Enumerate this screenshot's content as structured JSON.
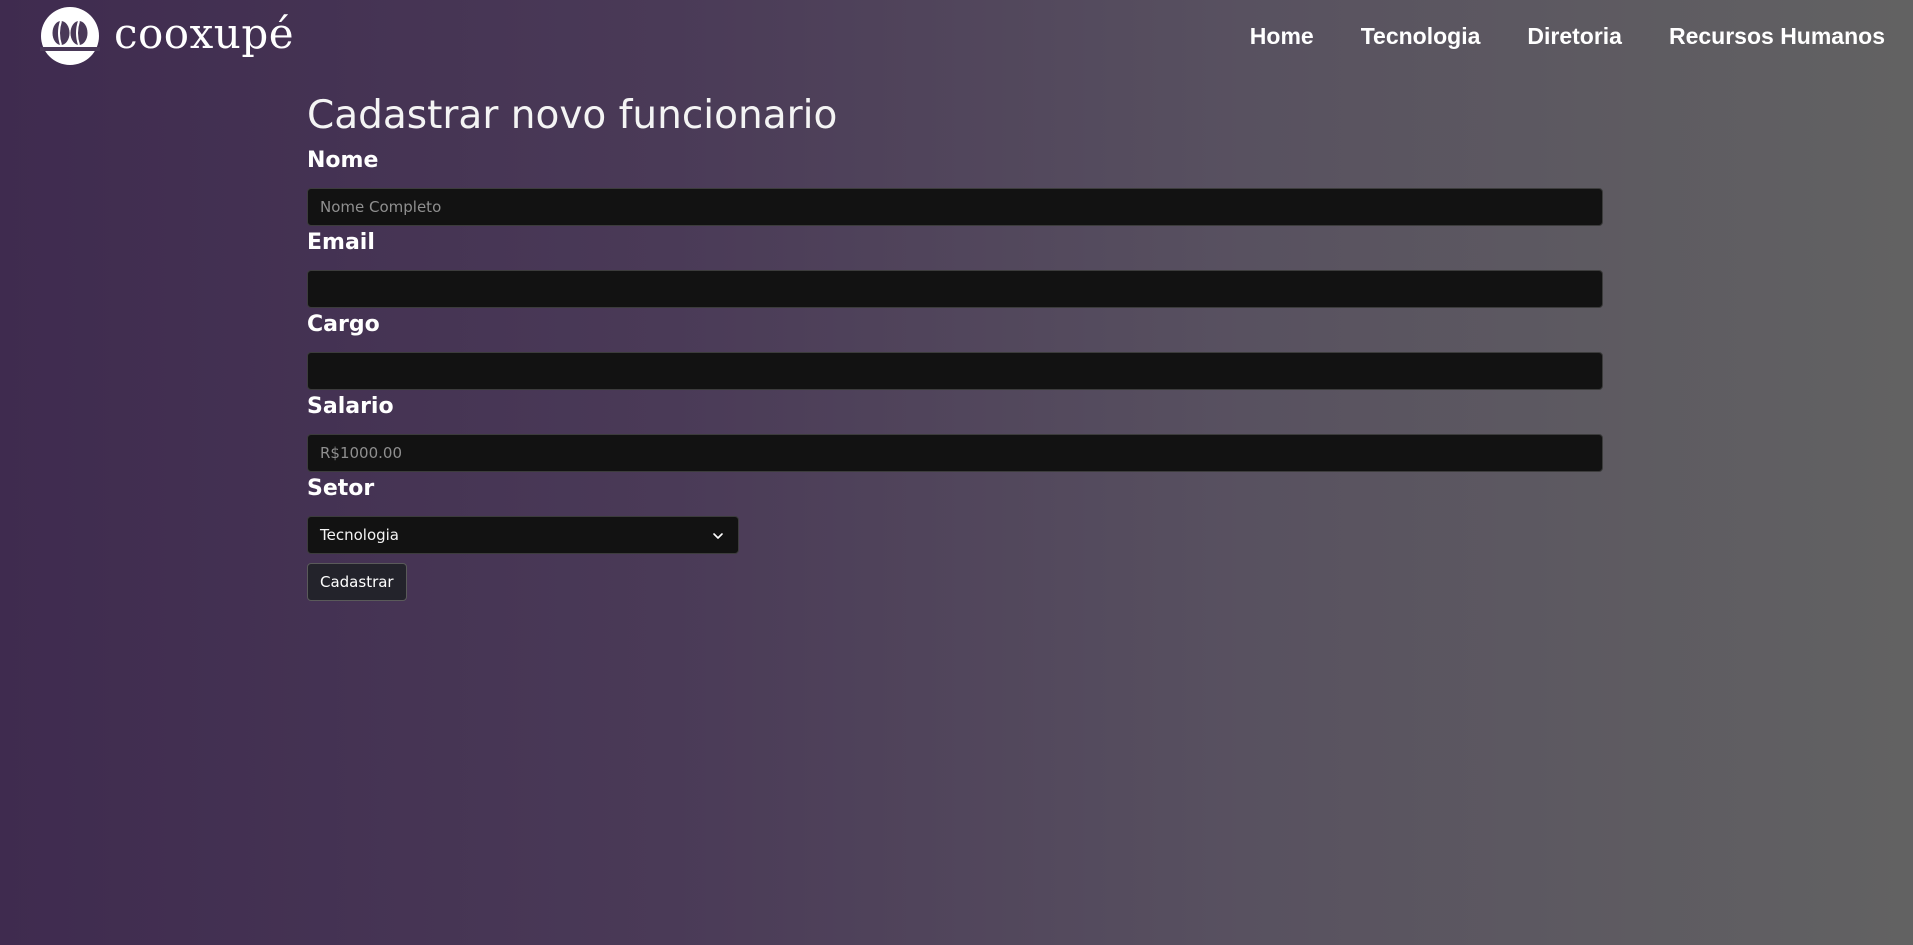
{
  "brand": {
    "name": "cooxupé",
    "logo_icon": "coffee-beans-logo"
  },
  "nav": {
    "items": [
      {
        "label": "Home"
      },
      {
        "label": "Tecnologia"
      },
      {
        "label": "Diretoria"
      },
      {
        "label": "Recursos Humanos"
      }
    ]
  },
  "form": {
    "title": "Cadastrar novo funcionario",
    "nome": {
      "label": "Nome",
      "placeholder": "Nome Completo",
      "value": ""
    },
    "email": {
      "label": "Email",
      "placeholder": "",
      "value": ""
    },
    "cargo": {
      "label": "Cargo",
      "placeholder": "",
      "value": ""
    },
    "salario": {
      "label": "Salario",
      "placeholder": "R$1000.00",
      "value": ""
    },
    "setor": {
      "label": "Setor",
      "selected": "Tecnologia"
    },
    "submit_label": "Cadastrar"
  },
  "colors": {
    "gradient_start": "#3f2b4f",
    "gradient_end": "#626262",
    "input_background": "#121212",
    "text": "#ffffff"
  }
}
